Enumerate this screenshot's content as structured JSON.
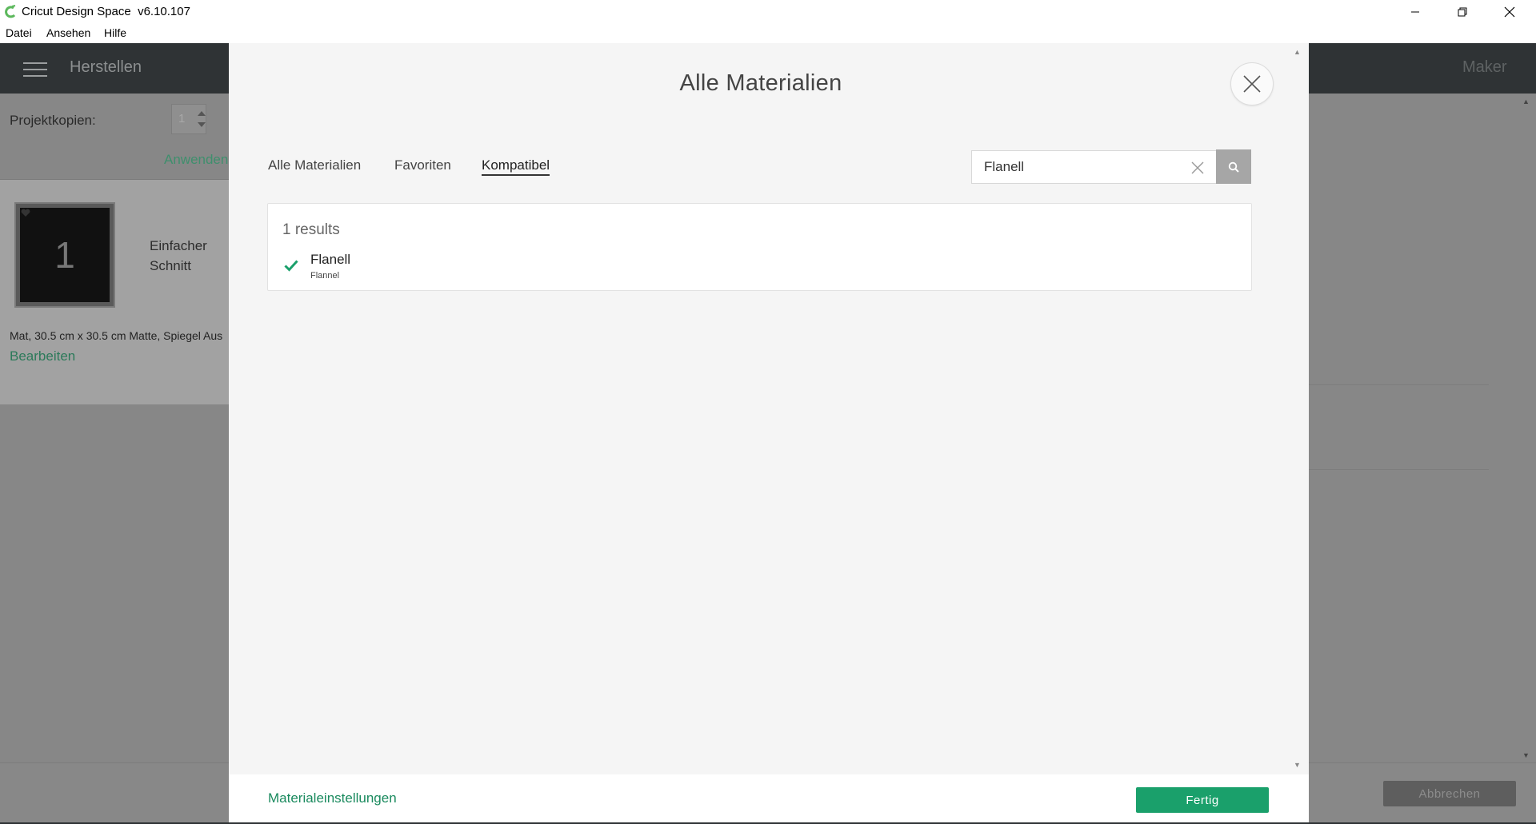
{
  "window": {
    "title": "Cricut Design Space  v6.10.107",
    "controls": {
      "minimize": "—",
      "restore": "❐",
      "close": "✕"
    }
  },
  "menu": [
    "Datei",
    "Ansehen",
    "Hilfe"
  ],
  "background": {
    "header_title": "Herstellen",
    "header_right": "Maker",
    "project_copies_label": "Projektkopien:",
    "project_copies_value": "1",
    "apply_label": "Anwenden",
    "mat_number": "1",
    "mat_label": "Einfacher Schnitt",
    "mat_info": "Mat, 30.5 cm x 30.5 cm Matte, Spiegel Aus",
    "edit_label": "Bearbeiten",
    "cancel_label": "Abbrechen"
  },
  "modal": {
    "title": "Alle Materialien",
    "tabs": [
      {
        "label": "Alle Materialien",
        "active": false
      },
      {
        "label": "Favoriten",
        "active": false
      },
      {
        "label": "Kompatibel",
        "active": true
      }
    ],
    "search": {
      "value": "Flanell"
    },
    "results_count": "1 results",
    "results": [
      {
        "name": "Flanell",
        "subtitle": "Flannel"
      }
    ],
    "footer": {
      "material_settings_label": "Materialeinstellungen",
      "done_label": "Fertig"
    }
  },
  "colors": {
    "accent_green": "#1aa06b",
    "link_green": "#1a8a5e",
    "header_dark": "#2f3335",
    "overlay_gray": "#878787"
  }
}
